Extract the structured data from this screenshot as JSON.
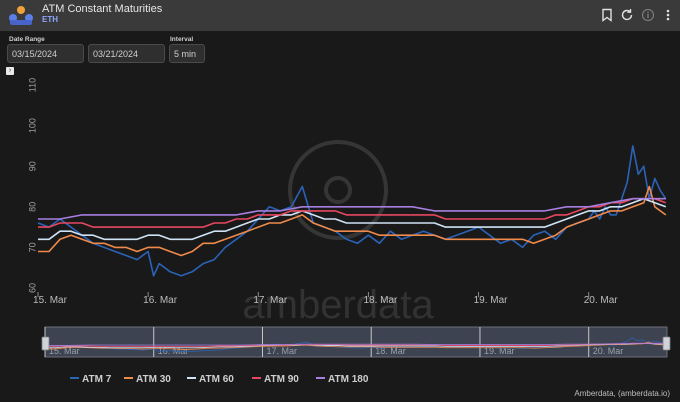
{
  "header": {
    "title": "ATM Constant Maturities",
    "subtitle": "ETH"
  },
  "controls": {
    "date_range_label": "Date Range",
    "start_date": "03/15/2024",
    "end_date": "03/21/2024",
    "interval_label": "Interval",
    "interval_value": "5 min"
  },
  "footer": {
    "credit": "Amberdata, (amberdata.io)"
  },
  "watermark": "amberdata",
  "colors": {
    "background": "#191919",
    "header": "#3a3a3a",
    "accent": "#8ea6ff"
  },
  "chart_data": {
    "type": "line",
    "x_tick_labels": [
      "15. Mar",
      "16. Mar",
      "17. Mar",
      "18. Mar",
      "19. Mar",
      "20. Mar"
    ],
    "y_tick_labels": [
      "60",
      "70",
      "80",
      "90",
      "100",
      "110"
    ],
    "ylim": [
      60,
      110
    ],
    "xlim": [
      15.0,
      20.72
    ],
    "grid": false,
    "legend_position": "bottom",
    "navigator": true,
    "series": [
      {
        "name": "ATM 7",
        "color": "#2a63b7",
        "x": [
          15.0,
          15.1,
          15.2,
          15.3,
          15.4,
          15.5,
          15.6,
          15.7,
          15.8,
          15.9,
          16.0,
          16.05,
          16.1,
          16.2,
          16.3,
          16.4,
          16.5,
          16.6,
          16.7,
          16.8,
          16.9,
          17.0,
          17.1,
          17.2,
          17.3,
          17.4,
          17.5,
          17.6,
          17.7,
          17.8,
          17.9,
          18.0,
          18.1,
          18.2,
          18.3,
          18.4,
          18.5,
          18.6,
          18.7,
          18.8,
          18.9,
          19.0,
          19.1,
          19.2,
          19.3,
          19.4,
          19.5,
          19.6,
          19.7,
          19.8,
          19.9,
          20.0,
          20.05,
          20.1,
          20.15,
          20.2,
          20.25,
          20.3,
          20.35,
          20.4,
          20.45,
          20.5,
          20.55,
          20.6,
          20.65,
          20.7
        ],
        "values": [
          76,
          75,
          77,
          75,
          73,
          71,
          70,
          69,
          68,
          67,
          69,
          63,
          66,
          64,
          63,
          64,
          66,
          67,
          70,
          72,
          74,
          77,
          80,
          79,
          80,
          85,
          76,
          75,
          74,
          72,
          71,
          73,
          71,
          74,
          72,
          73,
          74,
          73,
          72,
          73,
          74,
          75,
          73,
          71,
          72,
          70,
          73,
          74,
          72,
          75,
          76,
          77,
          79,
          77,
          80,
          78,
          78,
          82,
          86,
          95,
          88,
          90,
          82,
          87,
          84,
          82
        ]
      },
      {
        "name": "ATM 30",
        "color": "#f08a4b",
        "x": [
          15.0,
          15.1,
          15.2,
          15.3,
          15.4,
          15.5,
          15.6,
          15.7,
          15.8,
          15.9,
          16.0,
          16.1,
          16.2,
          16.3,
          16.4,
          16.5,
          16.6,
          16.7,
          16.8,
          16.9,
          17.0,
          17.1,
          17.2,
          17.3,
          17.4,
          17.5,
          17.6,
          17.7,
          17.8,
          17.9,
          18.0,
          18.1,
          18.2,
          18.3,
          18.4,
          18.5,
          18.6,
          18.7,
          18.8,
          18.9,
          19.0,
          19.1,
          19.2,
          19.3,
          19.4,
          19.5,
          19.6,
          19.7,
          19.8,
          19.9,
          20.0,
          20.1,
          20.2,
          20.3,
          20.4,
          20.5,
          20.55,
          20.6,
          20.65,
          20.7
        ],
        "values": [
          69,
          69,
          72,
          73,
          72,
          71,
          71,
          70,
          70,
          69,
          70,
          70,
          69,
          68,
          69,
          71,
          71,
          72,
          73,
          74,
          75,
          76,
          76,
          77,
          78,
          76,
          75,
          74,
          74,
          74,
          74,
          73,
          73,
          73,
          73,
          73,
          73,
          72,
          72,
          72,
          72,
          72,
          72,
          72,
          72,
          71,
          72,
          73,
          75,
          76,
          77,
          78,
          79,
          79,
          80,
          81,
          85,
          80,
          79,
          78
        ]
      },
      {
        "name": "ATM 60",
        "color": "#cfe3f5",
        "x": [
          15.0,
          15.1,
          15.2,
          15.3,
          15.4,
          15.5,
          15.6,
          15.7,
          15.8,
          15.9,
          16.0,
          16.1,
          16.2,
          16.3,
          16.4,
          16.5,
          16.6,
          16.7,
          16.8,
          16.9,
          17.0,
          17.1,
          17.2,
          17.3,
          17.4,
          17.5,
          17.6,
          17.7,
          17.8,
          17.9,
          18.0,
          18.1,
          18.2,
          18.3,
          18.4,
          18.5,
          18.6,
          18.7,
          18.8,
          18.9,
          19.0,
          19.1,
          19.2,
          19.3,
          19.4,
          19.5,
          19.6,
          19.7,
          19.8,
          19.9,
          20.0,
          20.1,
          20.2,
          20.3,
          20.4,
          20.5,
          20.6,
          20.7
        ],
        "values": [
          72,
          72,
          74,
          74,
          73,
          73,
          72,
          72,
          72,
          72,
          73,
          73,
          72,
          72,
          72,
          73,
          74,
          74,
          75,
          76,
          77,
          77,
          78,
          78,
          79,
          78,
          77,
          77,
          76,
          76,
          76,
          76,
          76,
          76,
          76,
          76,
          76,
          75,
          75,
          75,
          75,
          75,
          75,
          75,
          75,
          75,
          75,
          76,
          77,
          78,
          79,
          79,
          80,
          80,
          81,
          82,
          81,
          80
        ]
      },
      {
        "name": "ATM 90",
        "color": "#e8475f",
        "x": [
          15.0,
          15.1,
          15.2,
          15.3,
          15.4,
          15.5,
          15.6,
          15.7,
          15.8,
          15.9,
          16.0,
          16.1,
          16.2,
          16.3,
          16.4,
          16.5,
          16.6,
          16.7,
          16.8,
          16.9,
          17.0,
          17.1,
          17.2,
          17.3,
          17.4,
          17.5,
          17.6,
          17.7,
          17.8,
          17.9,
          18.0,
          18.1,
          18.2,
          18.3,
          18.4,
          18.5,
          18.6,
          18.7,
          18.8,
          18.9,
          19.0,
          19.1,
          19.2,
          19.3,
          19.4,
          19.5,
          19.6,
          19.7,
          19.8,
          19.9,
          20.0,
          20.1,
          20.2,
          20.3,
          20.4,
          20.5,
          20.6,
          20.7
        ],
        "values": [
          75,
          75,
          76,
          76,
          76,
          75,
          75,
          75,
          75,
          75,
          75,
          75,
          75,
          75,
          75,
          75,
          76,
          76,
          77,
          77,
          78,
          78,
          78,
          79,
          79,
          79,
          79,
          79,
          78,
          78,
          78,
          78,
          78,
          78,
          78,
          78,
          78,
          77,
          77,
          77,
          77,
          77,
          77,
          77,
          77,
          77,
          77,
          78,
          78,
          79,
          80,
          80,
          81,
          81,
          82,
          82,
          82,
          81
        ]
      },
      {
        "name": "ATM 180",
        "color": "#a77fe0",
        "x": [
          15.0,
          15.2,
          15.4,
          15.6,
          15.8,
          16.0,
          16.2,
          16.4,
          16.6,
          16.8,
          17.0,
          17.2,
          17.4,
          17.6,
          17.8,
          18.0,
          18.2,
          18.4,
          18.6,
          18.8,
          19.0,
          19.2,
          19.4,
          19.6,
          19.8,
          20.0,
          20.2,
          20.4,
          20.6,
          20.7
        ],
        "values": [
          77,
          77,
          78,
          78,
          78,
          78,
          78,
          78,
          78,
          78,
          79,
          79,
          80,
          80,
          80,
          80,
          80,
          80,
          79,
          79,
          79,
          79,
          79,
          79,
          80,
          80,
          81,
          82,
          82,
          82
        ]
      }
    ]
  }
}
